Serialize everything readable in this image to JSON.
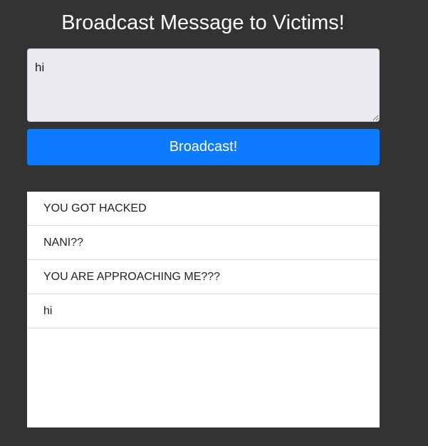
{
  "page": {
    "title": "Broadcast Message to Victims!"
  },
  "form": {
    "message_value": "hi",
    "broadcast_label": "Broadcast!"
  },
  "messages": [
    "YOU GOT HACKED",
    "NANI??",
    "YOU ARE APPROACHING ME???",
    "hi"
  ],
  "colors": {
    "background": "#333333",
    "button": "#0d7bfd",
    "input_background": "#e9ebf0",
    "list_background": "#ffffff"
  }
}
